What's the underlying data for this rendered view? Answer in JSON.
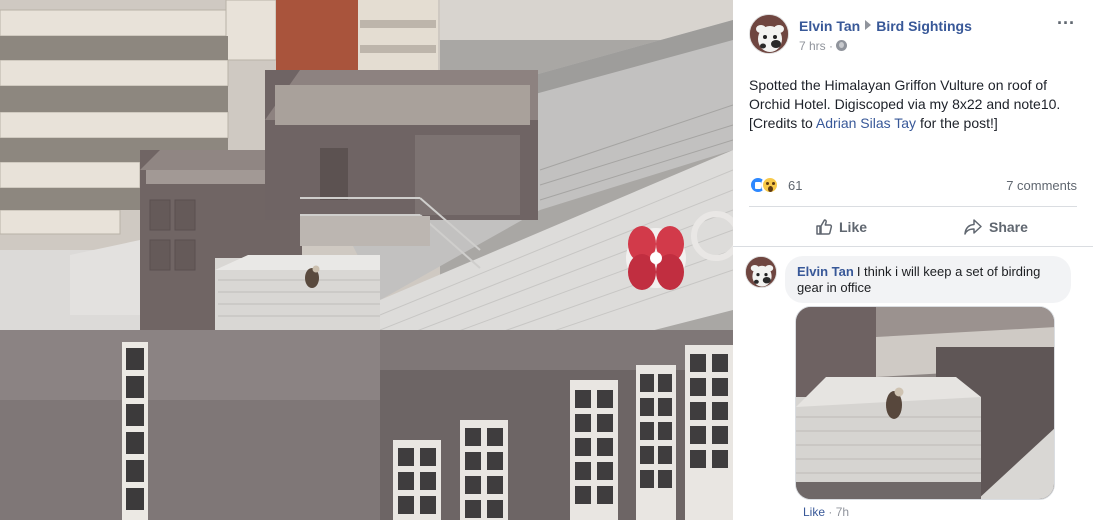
{
  "post": {
    "author": "Elvin Tan",
    "group": "Bird Sightings",
    "time": "7 hrs",
    "meta_sep": "·",
    "more_label": "···",
    "text_line1": "Spotted the Himalayan Griffon Vulture on roof of",
    "text_line2": "Orchid Hotel. Digiscoped via my 8x22 and note10.",
    "text_line3_prefix": "[Credits to ",
    "text_line3_link": "Adrian Silas Tay",
    "text_line3_suffix": " for the post!]",
    "reaction_count": "61",
    "comment_count": "7 comments",
    "actions": {
      "like": "Like",
      "share": "Share"
    }
  },
  "comment": {
    "author": "Elvin Tan",
    "text": "I think i will keep a set of birding gear in office",
    "like_label": "Like",
    "sep": "·",
    "time": "7h"
  },
  "colors": {
    "link": "#385898",
    "muted": "#90949c",
    "bubble": "#f2f3f5",
    "orchid": "#d23a4a",
    "like_blue": "#2d88ff"
  },
  "icons": [
    "globe-icon",
    "more-icon",
    "like-reaction-icon",
    "wow-reaction-icon",
    "thumbs-up-icon",
    "share-arrow-icon"
  ]
}
